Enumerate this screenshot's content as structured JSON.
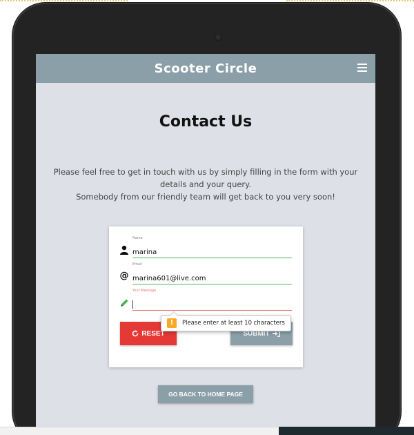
{
  "navbar": {
    "brand": "Scooter Circle",
    "menu_icon": "hamburger-icon"
  },
  "page": {
    "title": "Contact Us",
    "intro_line1": "Please feel free to get in touch with us by simply filling in the form with your details and your query.",
    "intro_line2": "Somebody from our friendly team will get back to you very soon!"
  },
  "form": {
    "name": {
      "label": "Name",
      "value": "marina",
      "icon": "user-icon"
    },
    "email": {
      "label": "Email",
      "value": "marina601@live.com",
      "icon": "at-icon"
    },
    "message": {
      "label": "Your Message",
      "value": "",
      "icon": "pencil-icon"
    },
    "reset_label": "RESET",
    "submit_label": "SUBMIT",
    "validation_message": "Please enter at least 10 characters"
  },
  "home_button_label": "GO BACK TO HOME PAGE",
  "colors": {
    "navbar": "#8a9fa8",
    "screen_bg": "#dde0e6",
    "reset": "#e53935",
    "valid_line": "#4caf50",
    "error_line": "#e57373"
  }
}
